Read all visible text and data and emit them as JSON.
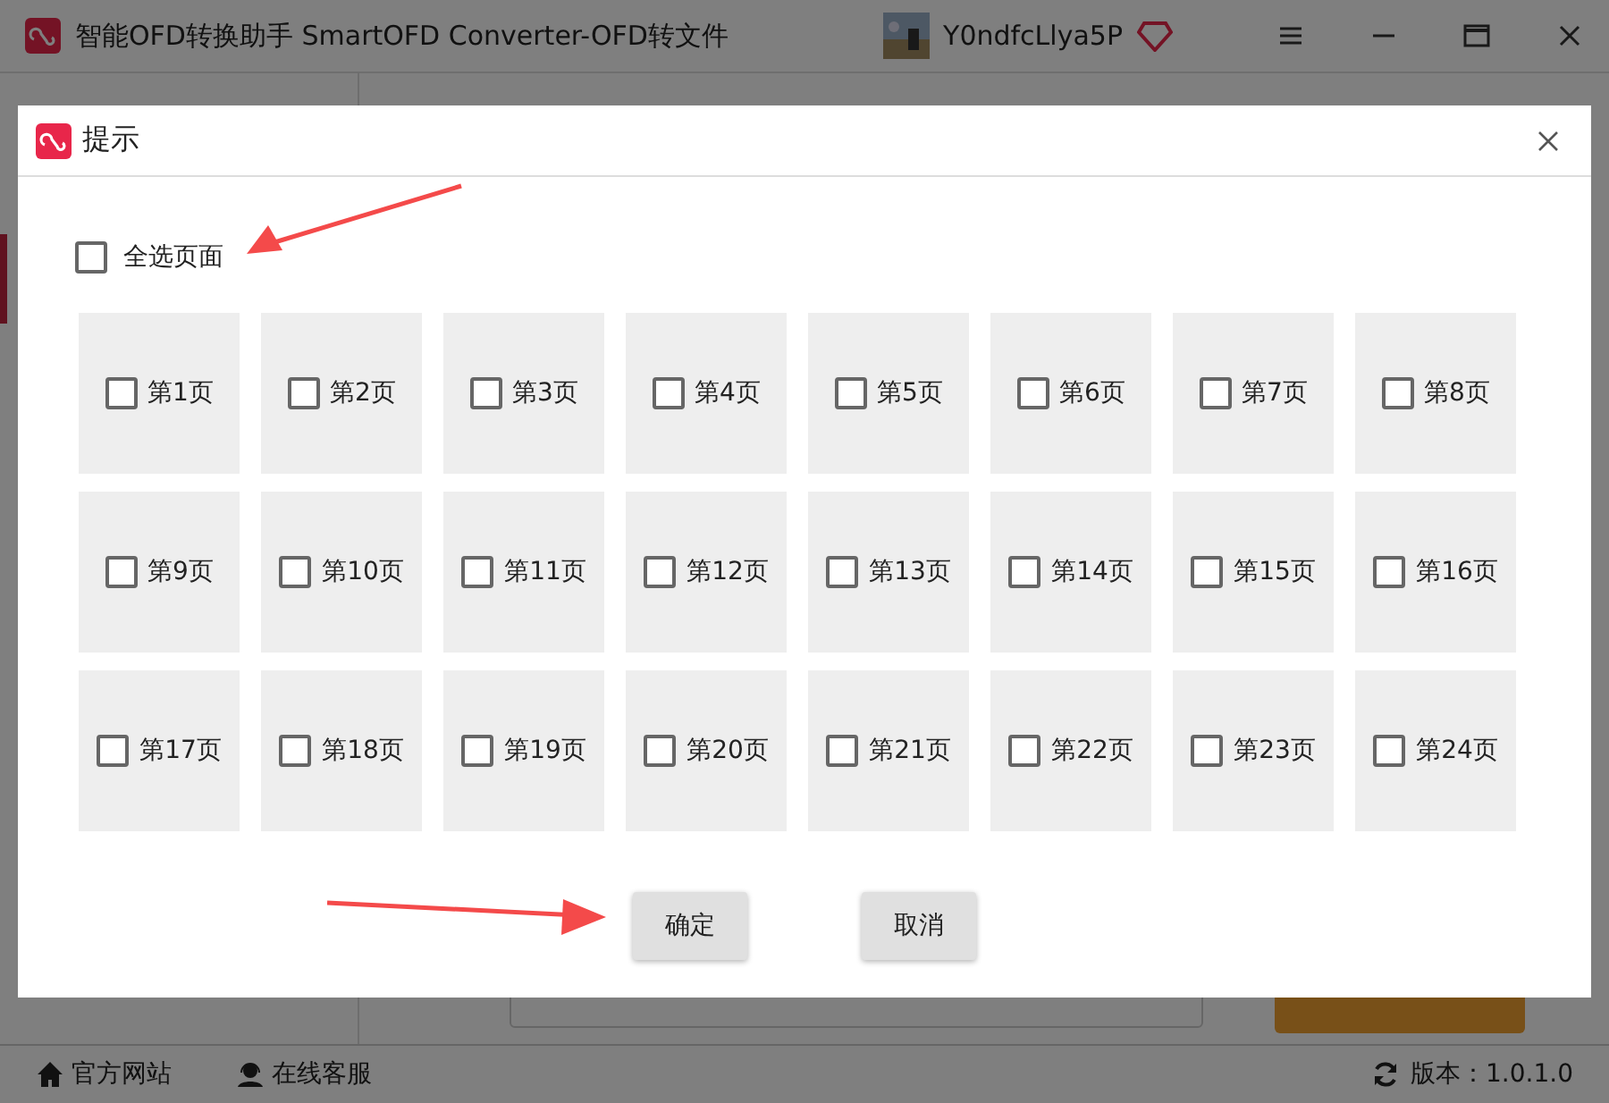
{
  "app": {
    "title": "智能OFD转换助手 SmartOFD Converter-OFD转文件",
    "user": "Y0ndfcLlya5P"
  },
  "status_bar": {
    "links": [
      {
        "kind": "home",
        "label": "官方网站"
      },
      {
        "kind": "support",
        "label": "在线客服"
      }
    ],
    "version": "版本：1.0.1.0"
  },
  "dialog": {
    "title": "提示",
    "select_all": {
      "label": "全选页面",
      "checked": false
    },
    "pages": [
      {
        "label": "第1页",
        "checked": false
      },
      {
        "label": "第2页",
        "checked": false
      },
      {
        "label": "第3页",
        "checked": false
      },
      {
        "label": "第4页",
        "checked": false
      },
      {
        "label": "第5页",
        "checked": false
      },
      {
        "label": "第6页",
        "checked": false
      },
      {
        "label": "第7页",
        "checked": false
      },
      {
        "label": "第8页",
        "checked": false
      },
      {
        "label": "第9页",
        "checked": false
      },
      {
        "label": "第10页",
        "checked": false
      },
      {
        "label": "第11页",
        "checked": false
      },
      {
        "label": "第12页",
        "checked": false
      },
      {
        "label": "第13页",
        "checked": false
      },
      {
        "label": "第14页",
        "checked": false
      },
      {
        "label": "第15页",
        "checked": false
      },
      {
        "label": "第16页",
        "checked": false
      },
      {
        "label": "第17页",
        "checked": false
      },
      {
        "label": "第18页",
        "checked": false
      },
      {
        "label": "第19页",
        "checked": false
      },
      {
        "label": "第20页",
        "checked": false
      },
      {
        "label": "第21页",
        "checked": false
      },
      {
        "label": "第22页",
        "checked": false
      },
      {
        "label": "第23页",
        "checked": false
      },
      {
        "label": "第24页",
        "checked": false
      }
    ],
    "buttons": [
      "确定",
      "取消"
    ]
  }
}
